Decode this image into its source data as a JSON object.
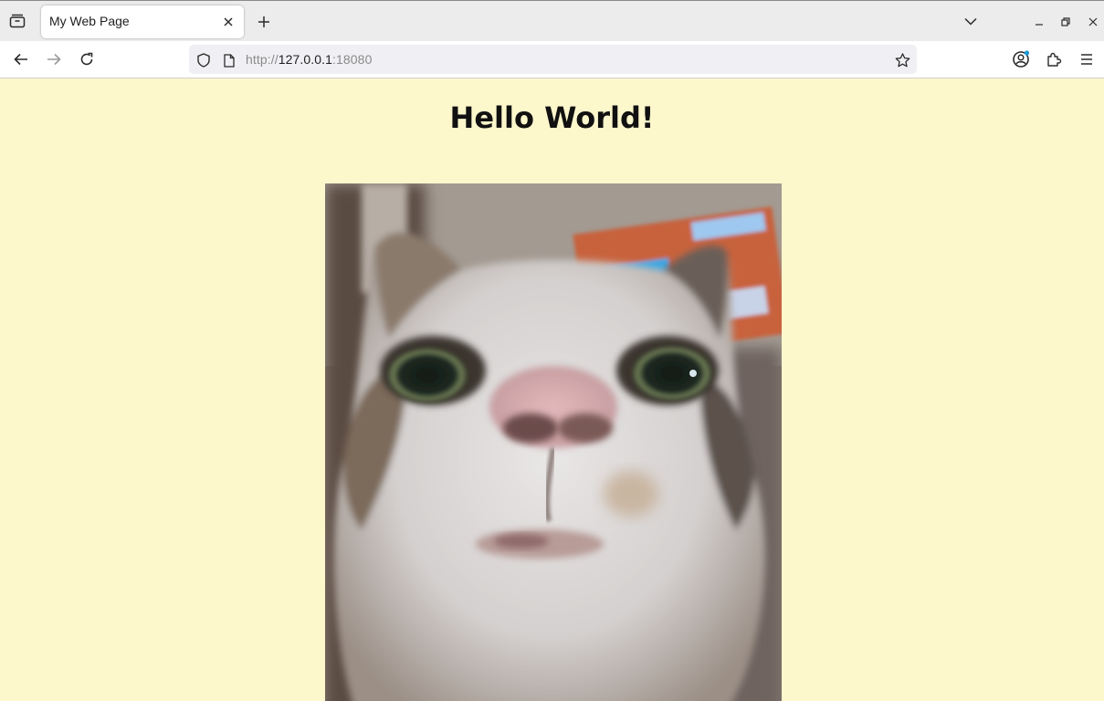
{
  "browser": {
    "tab": {
      "title": "My Web Page"
    },
    "url": {
      "scheme_prefix": "http://",
      "host": "127.0.0.1",
      "port_suffix": ":18080"
    }
  },
  "page": {
    "heading": "Hello World!",
    "image": {
      "subject": "cat-photo"
    }
  },
  "colors": {
    "page_background": "#fdf7cc",
    "tabbar_background": "#ececec",
    "urlbar_background": "#f0f0f4",
    "account_badge": "#1a9bd7"
  },
  "icons": [
    "tab-overview-icon",
    "close-icon",
    "new-tab-icon",
    "tab-list-chevron-icon",
    "minimize-icon",
    "restore-icon",
    "window-close-icon",
    "back-arrow-icon",
    "forward-arrow-icon",
    "reload-icon",
    "shield-icon",
    "page-icon",
    "bookmark-star-icon",
    "account-icon",
    "extensions-icon",
    "menu-icon"
  ]
}
